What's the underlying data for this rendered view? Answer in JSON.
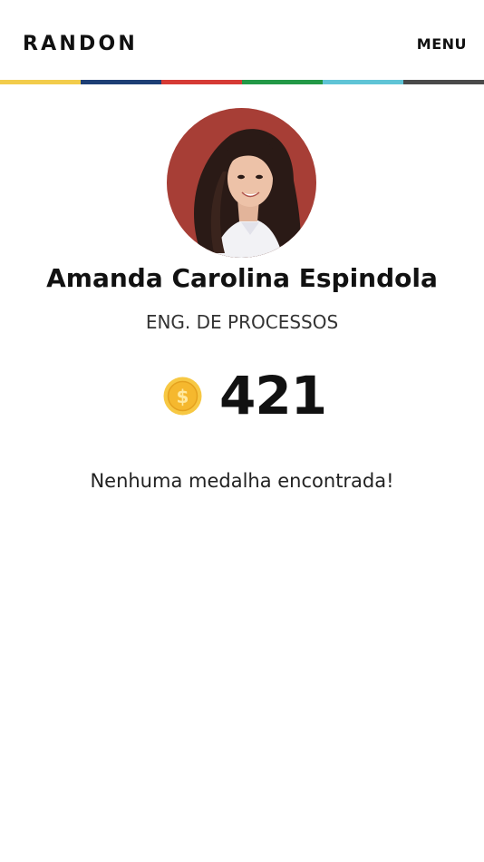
{
  "header": {
    "logo": "RANDON",
    "menu_label": "MENU",
    "stripe_colors": [
      "#f2cc4c",
      "#1d3f75",
      "#d63b35",
      "#239947",
      "#5fc4d6",
      "#4a4a4a"
    ]
  },
  "profile": {
    "name": "Amanda Carolina Espindola",
    "role": "ENG. DE PROCESSOS",
    "avatar_icon": "profile-photo"
  },
  "coins": {
    "icon": "coin-icon",
    "value": "421"
  },
  "medals": {
    "empty_message": "Nenhuma medalha encontrada!"
  },
  "colors": {
    "coin": "#f5b82e",
    "avatar_bg": "#b4463c"
  }
}
